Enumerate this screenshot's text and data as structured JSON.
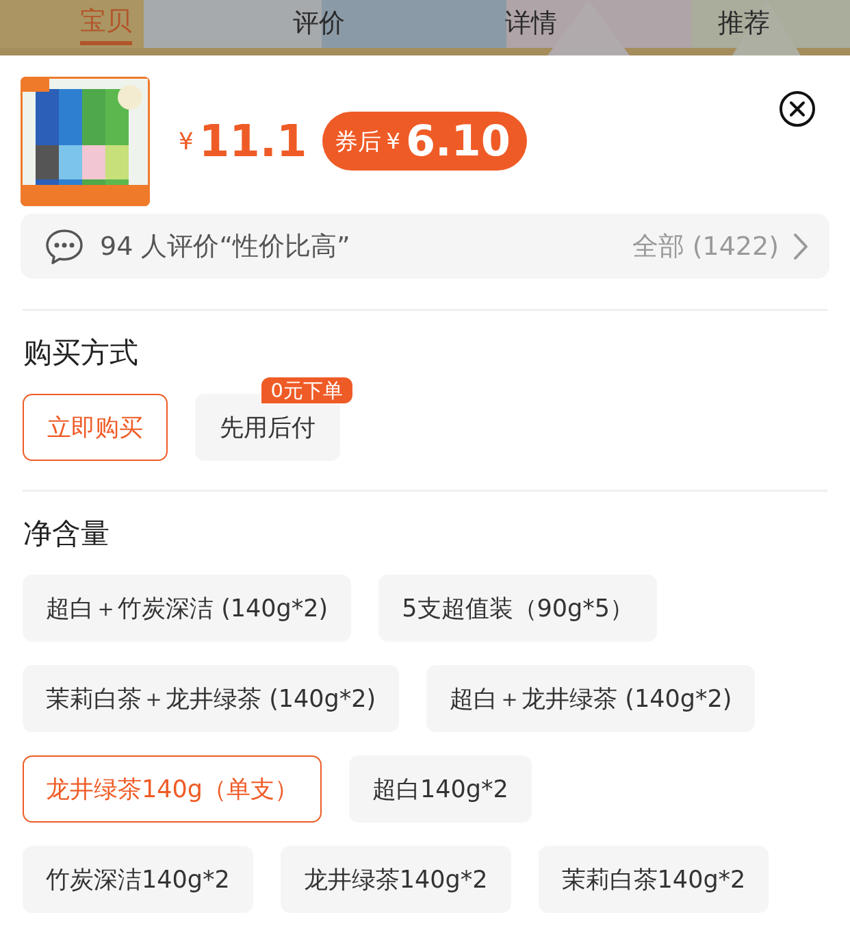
{
  "tabs": [
    {
      "label": "宝贝",
      "selected": true
    },
    {
      "label": "评价",
      "selected": false
    },
    {
      "label": "详情",
      "selected": false
    },
    {
      "label": "推荐",
      "selected": false
    }
  ],
  "product": {
    "currency": "¥",
    "price": "11.1",
    "coupon": {
      "label": "券后",
      "currency": "¥",
      "price": "6.10"
    }
  },
  "reviews": {
    "summary": "94 人评价“性价比高”",
    "all_link": "全部 (1422)"
  },
  "purchase": {
    "title": "购买方式",
    "options": [
      {
        "label": "立即购买",
        "selected": true
      },
      {
        "label": "先用后付",
        "selected": false,
        "badge": "0元下单"
      }
    ]
  },
  "net_content": {
    "title": "净含量",
    "rows": [
      {
        "options": [
          {
            "label": "超白＋竹炭深洁 (140g*2)",
            "selected": false
          },
          {
            "label": "5支超值装（90g*5）",
            "selected": false
          }
        ]
      },
      {
        "options": [
          {
            "label": "茉莉白茶＋龙井绿茶 (140g*2)",
            "selected": false
          },
          {
            "label": "超白＋龙井绿茶 (140g*2)",
            "selected": false
          }
        ]
      },
      {
        "options": [
          {
            "label": "龙井绿茶140g（单支）",
            "selected": true
          },
          {
            "label": "超白140g*2",
            "selected": false
          }
        ]
      },
      {
        "options": [
          {
            "label": "竹炭深洁140g*2",
            "selected": false
          },
          {
            "label": "龙井绿茶140g*2",
            "selected": false
          },
          {
            "label": "茉莉白茶140g*2",
            "selected": false
          }
        ]
      }
    ]
  }
}
